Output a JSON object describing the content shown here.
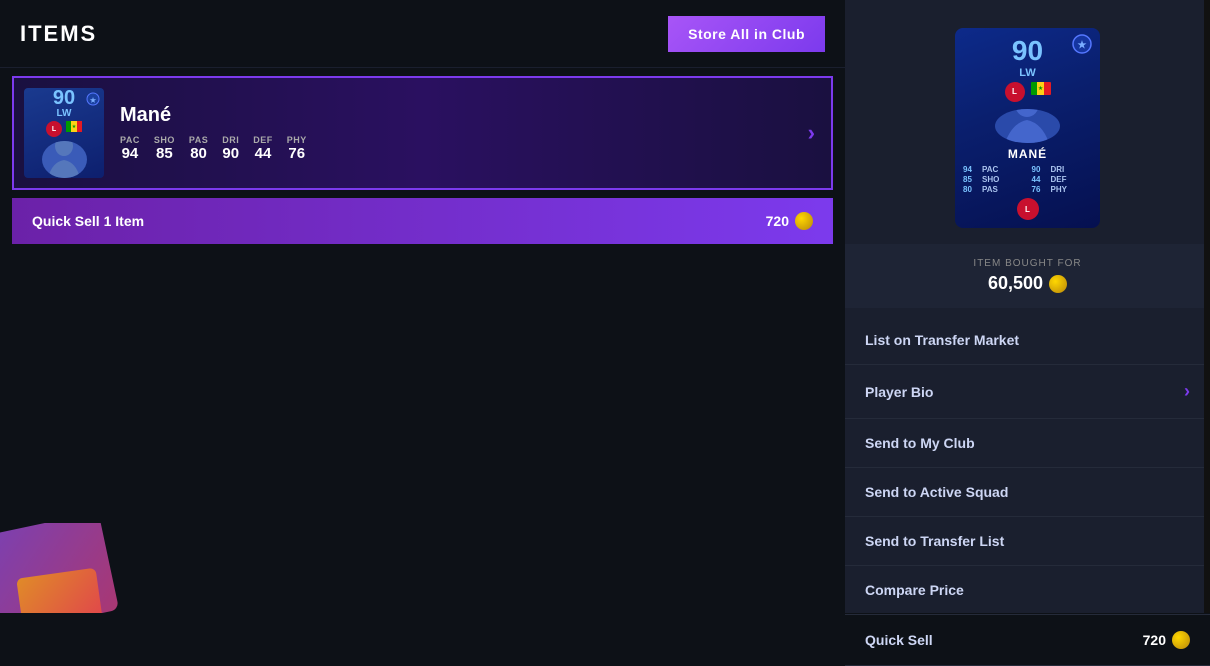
{
  "header": {
    "title": "ITEMS",
    "store_all_btn": "Store All in Club"
  },
  "player": {
    "name": "Mané",
    "rating": "90",
    "position": "LW",
    "pac": "94",
    "sho": "85",
    "pas": "80",
    "dri": "90",
    "def": "44",
    "phy": "76",
    "pac_label": "PAC",
    "sho_label": "SHO",
    "pas_label": "PAS",
    "dri_label": "DRI",
    "def_label": "DEF",
    "phy_label": "PHY"
  },
  "quick_sell": {
    "label": "Quick Sell 1 Item",
    "value": "720"
  },
  "item_bought": {
    "label": "ITEM BOUGHT FOR",
    "value": "60,500"
  },
  "actions": [
    {
      "id": "list-transfer-market",
      "label": "List on Transfer Market",
      "chevron": false,
      "right_value": ""
    },
    {
      "id": "player-bio",
      "label": "Player Bio",
      "chevron": true,
      "right_value": ""
    },
    {
      "id": "send-my-club",
      "label": "Send to My Club",
      "chevron": false,
      "right_value": ""
    },
    {
      "id": "send-active-squad",
      "label": "Send to Active Squad",
      "chevron": false,
      "right_value": ""
    },
    {
      "id": "send-transfer-list",
      "label": "Send to Transfer List",
      "chevron": false,
      "right_value": ""
    },
    {
      "id": "compare-price",
      "label": "Compare Price",
      "chevron": false,
      "right_value": ""
    },
    {
      "id": "quick-sell",
      "label": "Quick Sell",
      "chevron": false,
      "right_value": "720"
    }
  ],
  "card_large": {
    "rating": "90",
    "position": "LW",
    "name": "MANÉ",
    "stats": [
      {
        "val": "94",
        "lbl": "PAC"
      },
      {
        "val": "90",
        "lbl": "DRI"
      },
      {
        "val": "85",
        "lbl": "SHO"
      },
      {
        "val": "44",
        "lbl": "DEF"
      },
      {
        "val": "80",
        "lbl": "PAS"
      },
      {
        "val": "76",
        "lbl": "PHY"
      }
    ]
  }
}
